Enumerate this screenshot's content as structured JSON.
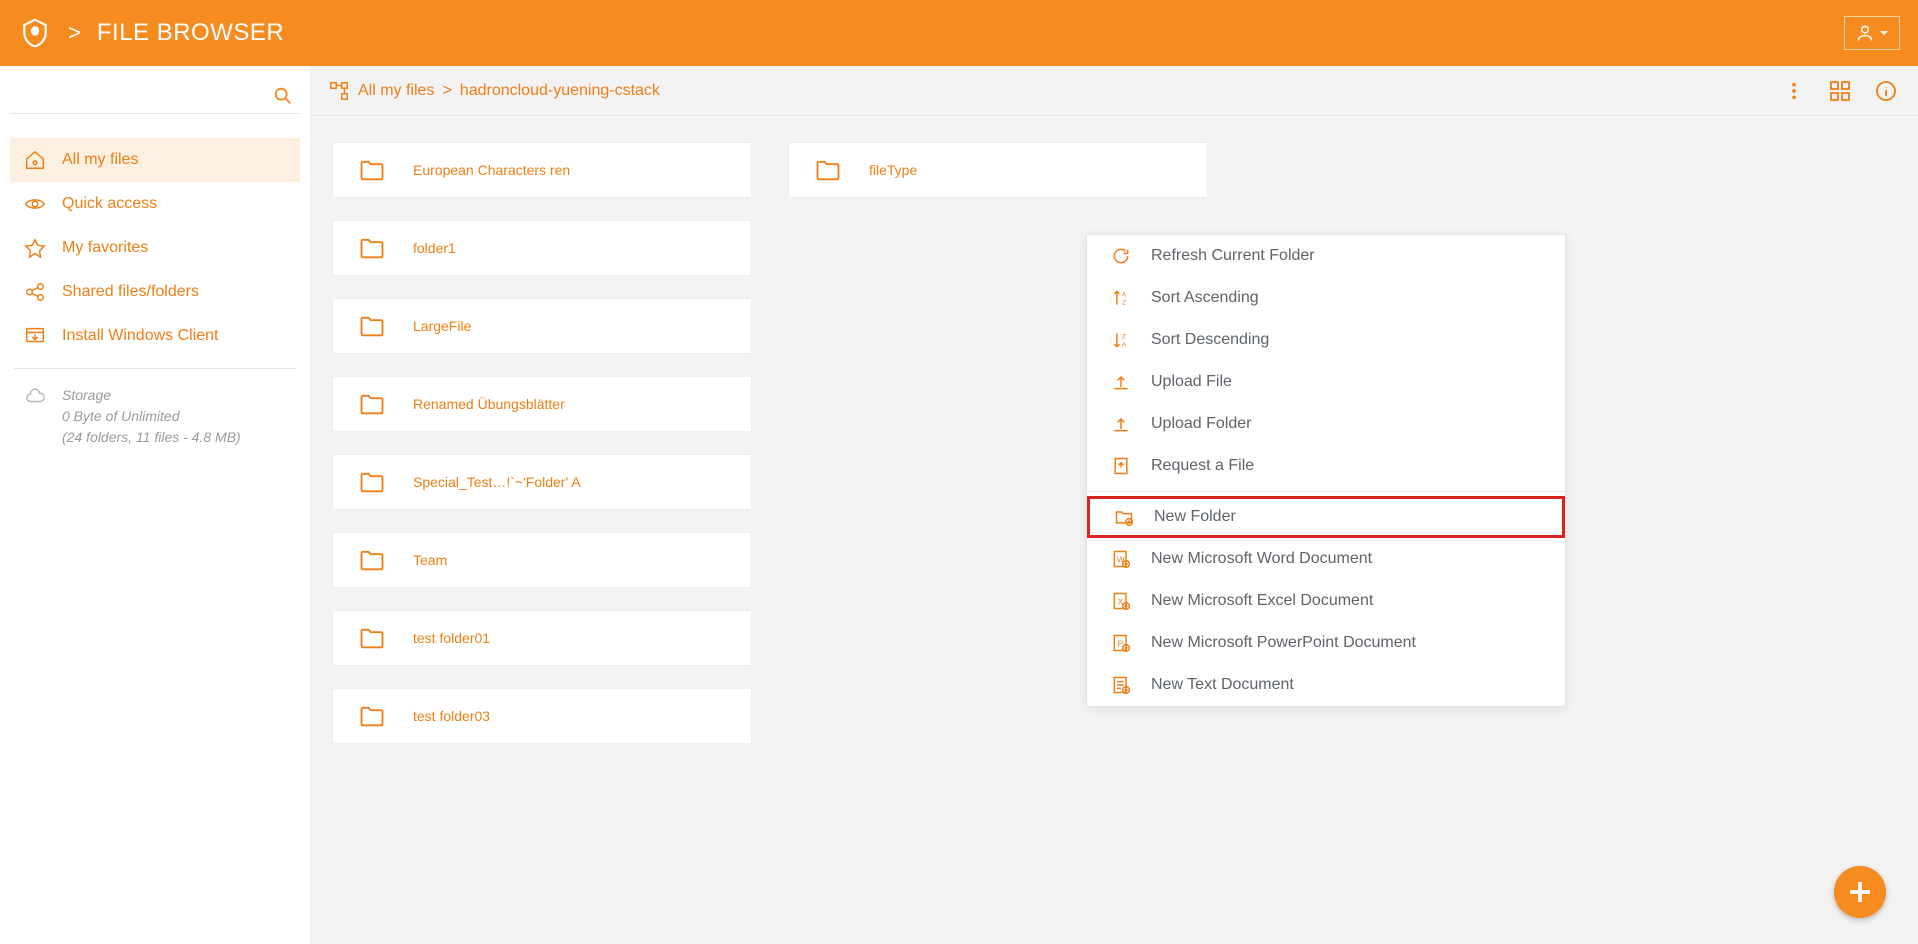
{
  "header": {
    "title": "FILE BROWSER"
  },
  "search": {
    "placeholder": ""
  },
  "sidebar": {
    "items": [
      {
        "label": "All my files"
      },
      {
        "label": "Quick access"
      },
      {
        "label": "My favorites"
      },
      {
        "label": "Shared files/folders"
      },
      {
        "label": "Install Windows Client"
      }
    ],
    "storage": {
      "title": "Storage",
      "line1": "0 Byte of Unlimited",
      "line2": "(24 folders, 11 files - 4.8 MB)"
    }
  },
  "breadcrumb": {
    "root": "All my files",
    "current": "hadroncloud-yuening-cstack"
  },
  "folders_col1": [
    {
      "name": "European Characters ren"
    },
    {
      "name": "folder1"
    },
    {
      "name": "LargeFile"
    },
    {
      "name": "Renamed Übungsblätter"
    },
    {
      "name": "Special_Test…!`~'Folder' A"
    },
    {
      "name": "Team"
    },
    {
      "name": "test folder01"
    },
    {
      "name": "test folder03"
    }
  ],
  "folders_col2": [
    {
      "name": "fileType"
    }
  ],
  "context_menu": {
    "group1": [
      {
        "label": "Refresh Current Folder",
        "icon": "refresh-icon"
      },
      {
        "label": "Sort Ascending",
        "icon": "sort-asc-icon"
      },
      {
        "label": "Sort Descending",
        "icon": "sort-desc-icon"
      },
      {
        "label": "Upload File",
        "icon": "upload-file-icon"
      },
      {
        "label": "Upload Folder",
        "icon": "upload-folder-icon"
      },
      {
        "label": "Request a File",
        "icon": "request-file-icon"
      }
    ],
    "group2": [
      {
        "label": "New Folder",
        "icon": "new-folder-icon",
        "highlight": true
      },
      {
        "label": "New Microsoft Word Document",
        "icon": "new-word-icon"
      },
      {
        "label": "New Microsoft Excel Document",
        "icon": "new-excel-icon"
      },
      {
        "label": "New Microsoft PowerPoint Document",
        "icon": "new-ppt-icon"
      },
      {
        "label": "New Text Document",
        "icon": "new-text-icon"
      }
    ]
  }
}
